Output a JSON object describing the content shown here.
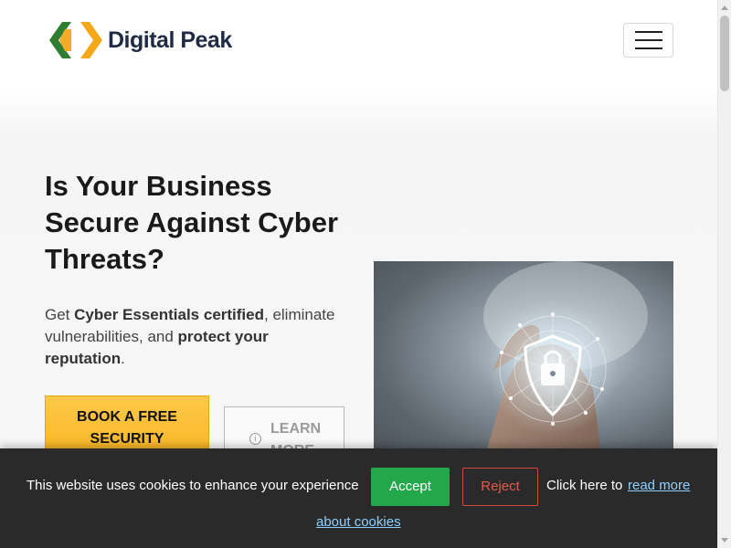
{
  "brand": {
    "name": "Digital Peak",
    "colors": {
      "green": "#2e7d32",
      "orange": "#f4a819",
      "navy": "#1f2a44"
    }
  },
  "header": {
    "menu_icon": "hamburger-menu-icon"
  },
  "hero": {
    "title": "Is Your Business Secure Against Cyber Threats?",
    "subtitle_parts": {
      "p1": "Get ",
      "b1": "Cyber Essentials certified",
      "p2": ", eliminate vulnerabilities, and ",
      "b2": "protect your reputation",
      "p3": "."
    },
    "primary_button": "BOOK A FREE SECURITY",
    "secondary_button": "LEARN MORE",
    "secondary_icon": "info-icon",
    "image_icon": "shield-lock-icon"
  },
  "cookie_banner": {
    "message": "This website uses cookies to enhance your experience",
    "accept": "Accept",
    "reject": "Reject",
    "click_text": "Click here to",
    "link_part1": "read more",
    "link_part2": "about cookies",
    "colors": {
      "accept": "#22a84a",
      "reject": "#d44a3a",
      "link": "#8fd0ff"
    }
  }
}
